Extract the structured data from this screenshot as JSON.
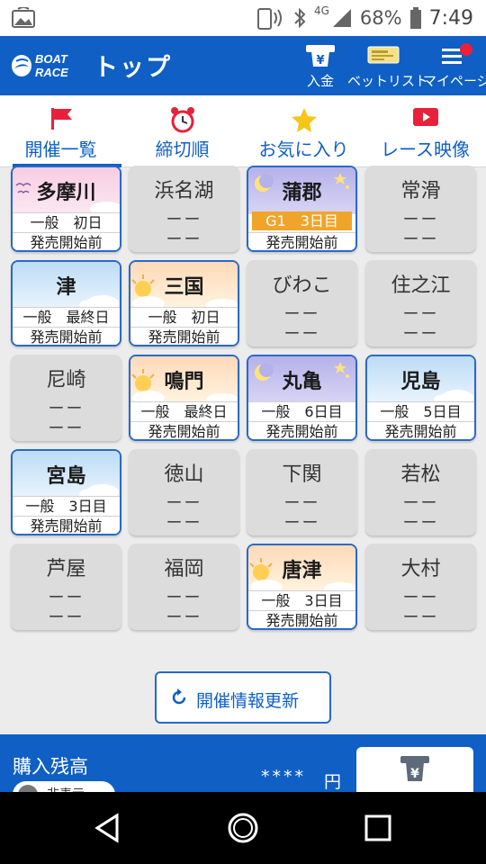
{
  "status_bar": {
    "network_type": "4G",
    "battery_percent": "68%",
    "time": "7:49",
    "icons": [
      "image-placeholder-icon",
      "nfc-icon",
      "bluetooth-icon",
      "signal-icon",
      "battery-icon"
    ]
  },
  "app_bar": {
    "logo_lines": [
      "BOAT",
      "RACE"
    ],
    "title": "トップ",
    "buttons": [
      {
        "label": "入金",
        "icon": "deposit-icon"
      },
      {
        "label": "ベットリスト",
        "icon": "ticket-icon"
      },
      {
        "label": "マイページ",
        "icon": "menu-icon"
      }
    ],
    "notification_color": "#e8203a"
  },
  "tabs": [
    {
      "label": "開催一覧",
      "icon": "flag-icon",
      "active": true
    },
    {
      "label": "締切順",
      "icon": "alarm-clock-icon",
      "active": false
    },
    {
      "label": "お気に入り",
      "icon": "star-icon",
      "active": false
    },
    {
      "label": "レース映像",
      "icon": "video-play-icon",
      "active": false
    }
  ],
  "venues": [
    {
      "name": "多摩川",
      "open": true,
      "theme": "pink",
      "grade": "一般",
      "day": "初日",
      "status": "発売開始前"
    },
    {
      "name": "浜名湖",
      "open": false,
      "dash": "ーー"
    },
    {
      "name": "蒲郡",
      "open": true,
      "theme": "night",
      "grade": "G1",
      "day": "3日目",
      "status": "発売開始前",
      "highlight": true
    },
    {
      "name": "常滑",
      "open": false,
      "dash": "ーー"
    },
    {
      "name": "津",
      "open": true,
      "theme": "sky",
      "grade": "一般",
      "day": "最終日",
      "status": "発売開始前"
    },
    {
      "name": "三国",
      "open": true,
      "theme": "sunrise",
      "grade": "一般",
      "day": "初日",
      "status": "発売開始前"
    },
    {
      "name": "びわこ",
      "open": false,
      "dash": "ーー"
    },
    {
      "name": "住之江",
      "open": false,
      "dash": "ーー"
    },
    {
      "name": "尼崎",
      "open": false,
      "dash": "ーー"
    },
    {
      "name": "鳴門",
      "open": true,
      "theme": "sunrise",
      "grade": "一般",
      "day": "最終日",
      "status": "発売開始前"
    },
    {
      "name": "丸亀",
      "open": true,
      "theme": "night",
      "grade": "一般",
      "day": "6日目",
      "status": "発売開始前"
    },
    {
      "name": "児島",
      "open": true,
      "theme": "sky",
      "grade": "一般",
      "day": "5日目",
      "status": "発売開始前"
    },
    {
      "name": "宮島",
      "open": true,
      "theme": "sky",
      "grade": "一般",
      "day": "3日目",
      "status": "発売開始前"
    },
    {
      "name": "徳山",
      "open": false,
      "dash": "ーー"
    },
    {
      "name": "下関",
      "open": false,
      "dash": "ーー"
    },
    {
      "name": "若松",
      "open": false,
      "dash": "ーー"
    },
    {
      "name": "芦屋",
      "open": false,
      "dash": "ーー"
    },
    {
      "name": "福岡",
      "open": false,
      "dash": "ーー"
    },
    {
      "name": "唐津",
      "open": true,
      "theme": "sunrise",
      "grade": "一般",
      "day": "3日目",
      "status": "発売開始前"
    },
    {
      "name": "大村",
      "open": false,
      "dash": "ーー"
    }
  ],
  "refresh_button": {
    "label": "開催情報更新",
    "icon": "refresh-icon"
  },
  "balance": {
    "title": "購入残高",
    "amount": "****",
    "currency": "円",
    "toggle_label": "非表示",
    "deposit_icon": "deposit-icon"
  },
  "colors": {
    "brand": "#0f5fc5",
    "grade_badge": "#f0a52a",
    "card_border": "#2a69c9"
  }
}
